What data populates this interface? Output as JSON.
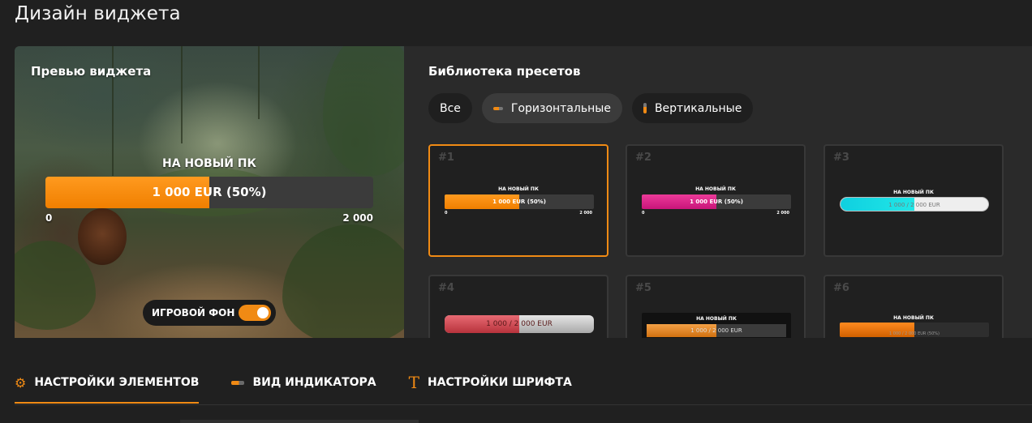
{
  "page": {
    "title": "Дизайн виджета"
  },
  "preview": {
    "label": "Превью виджета",
    "widget": {
      "title": "НА НОВЫЙ ПК",
      "value_text": "1 000 EUR (50%)",
      "progress": 0.5,
      "min": "0",
      "max": "2 000"
    },
    "game_bg": {
      "label": "ИГРОВОЙ ФОН",
      "enabled": true
    }
  },
  "library": {
    "title": "Библиотека пресетов",
    "filters": [
      {
        "label": "Все",
        "icon": "",
        "active": false
      },
      {
        "label": "Горизонтальные",
        "icon": "horizontal-bar-icon",
        "active": true
      },
      {
        "label": "Вертикальные",
        "icon": "vertical-bar-icon",
        "active": false
      }
    ],
    "presets": [
      {
        "num": "#1",
        "title": "НА НОВЫЙ ПК",
        "value": "1 000 EUR (50%)",
        "min": "0",
        "max": "2 000",
        "fill": "#f08a14",
        "progress": 0.5,
        "selected": true
      },
      {
        "num": "#2",
        "title": "НА НОВЫЙ ПК",
        "value": "1 000 EUR (50%)",
        "min": "0",
        "max": "2 000",
        "fill": "#e0248a",
        "progress": 0.5,
        "selected": false
      },
      {
        "num": "#3",
        "title": "НА НОВЫЙ ПК",
        "value": "1 000 / 2 000 EUR",
        "fill": "#19d6e0",
        "progress": 0.5,
        "selected": false
      },
      {
        "num": "#4",
        "title": "",
        "value": "1 000 / 2 000 EUR",
        "fill": "#c9454f",
        "progress": 0.5,
        "selected": false
      },
      {
        "num": "#5",
        "title": "НА НОВЫЙ ПК",
        "value": "1 000 / 2 000 EUR",
        "fill": "#f08a14",
        "progress": 0.5,
        "selected": false
      },
      {
        "num": "#6",
        "title": "НА НОВЫЙ ПК",
        "value": "1 000 / 2 000 EUR (50%)",
        "fill": "#f08a14",
        "progress": 0.5,
        "selected": false
      }
    ]
  },
  "tabs": [
    {
      "label": "НАСТРОЙКИ ЭЛЕМЕНТОВ",
      "icon": "gear-icon",
      "active": true
    },
    {
      "label": "ВИД ИНДИКАТОРА",
      "icon": "indicator-bar-icon",
      "active": false
    },
    {
      "label": "НАСТРОЙКИ ШРИФТА",
      "icon": "font-t-icon",
      "active": false
    }
  ],
  "colors": {
    "accent": "#f08a14",
    "background": "#202020",
    "panel": "#2a2a2a"
  }
}
